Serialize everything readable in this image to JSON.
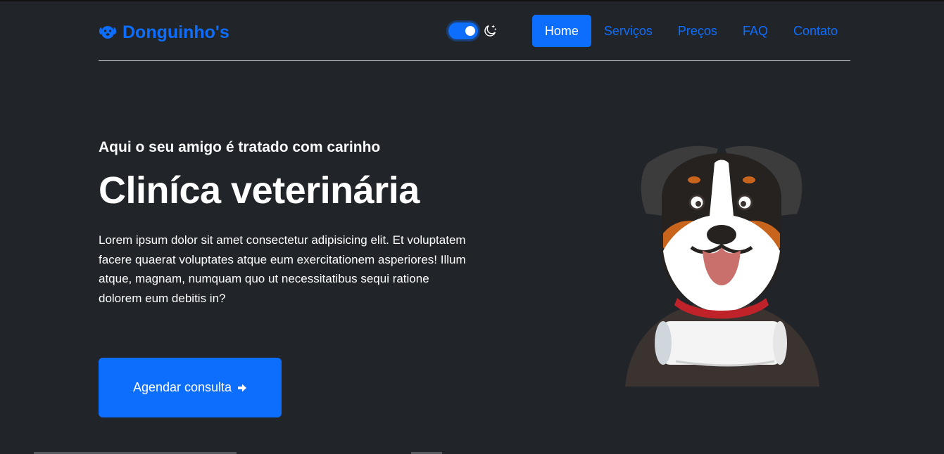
{
  "brand": {
    "name": "Donguinho's",
    "icon": "dog-icon",
    "color": "#0d6efd"
  },
  "theme_toggle": {
    "state": "dark",
    "checked": true,
    "icon": "moon-stars-icon"
  },
  "nav": {
    "items": [
      {
        "label": "Home",
        "active": true
      },
      {
        "label": "Serviços",
        "active": false
      },
      {
        "label": "Preços",
        "active": false
      },
      {
        "label": "FAQ",
        "active": false
      },
      {
        "label": "Contato",
        "active": false
      }
    ]
  },
  "hero": {
    "subtitle": "Aqui o seu amigo é tratado com carinho",
    "title": "Cliníca veterinária",
    "text": "Lorem ipsum dolor sit amet consectetur adipisicing elit. Et voluptatem facere quaerat voluptates atque eum exercitationem asperiores! Illum atque, magnam, numquam quo ut necessitatibus sequi ratione dolorem eum debitis in?",
    "cta_label": "Agendar consulta",
    "cta_icon": "arrow-right-icon",
    "illustration": "dog-with-bone-illustration"
  },
  "colors": {
    "background": "#212529",
    "accent": "#0d6efd",
    "text": "#ffffff"
  }
}
